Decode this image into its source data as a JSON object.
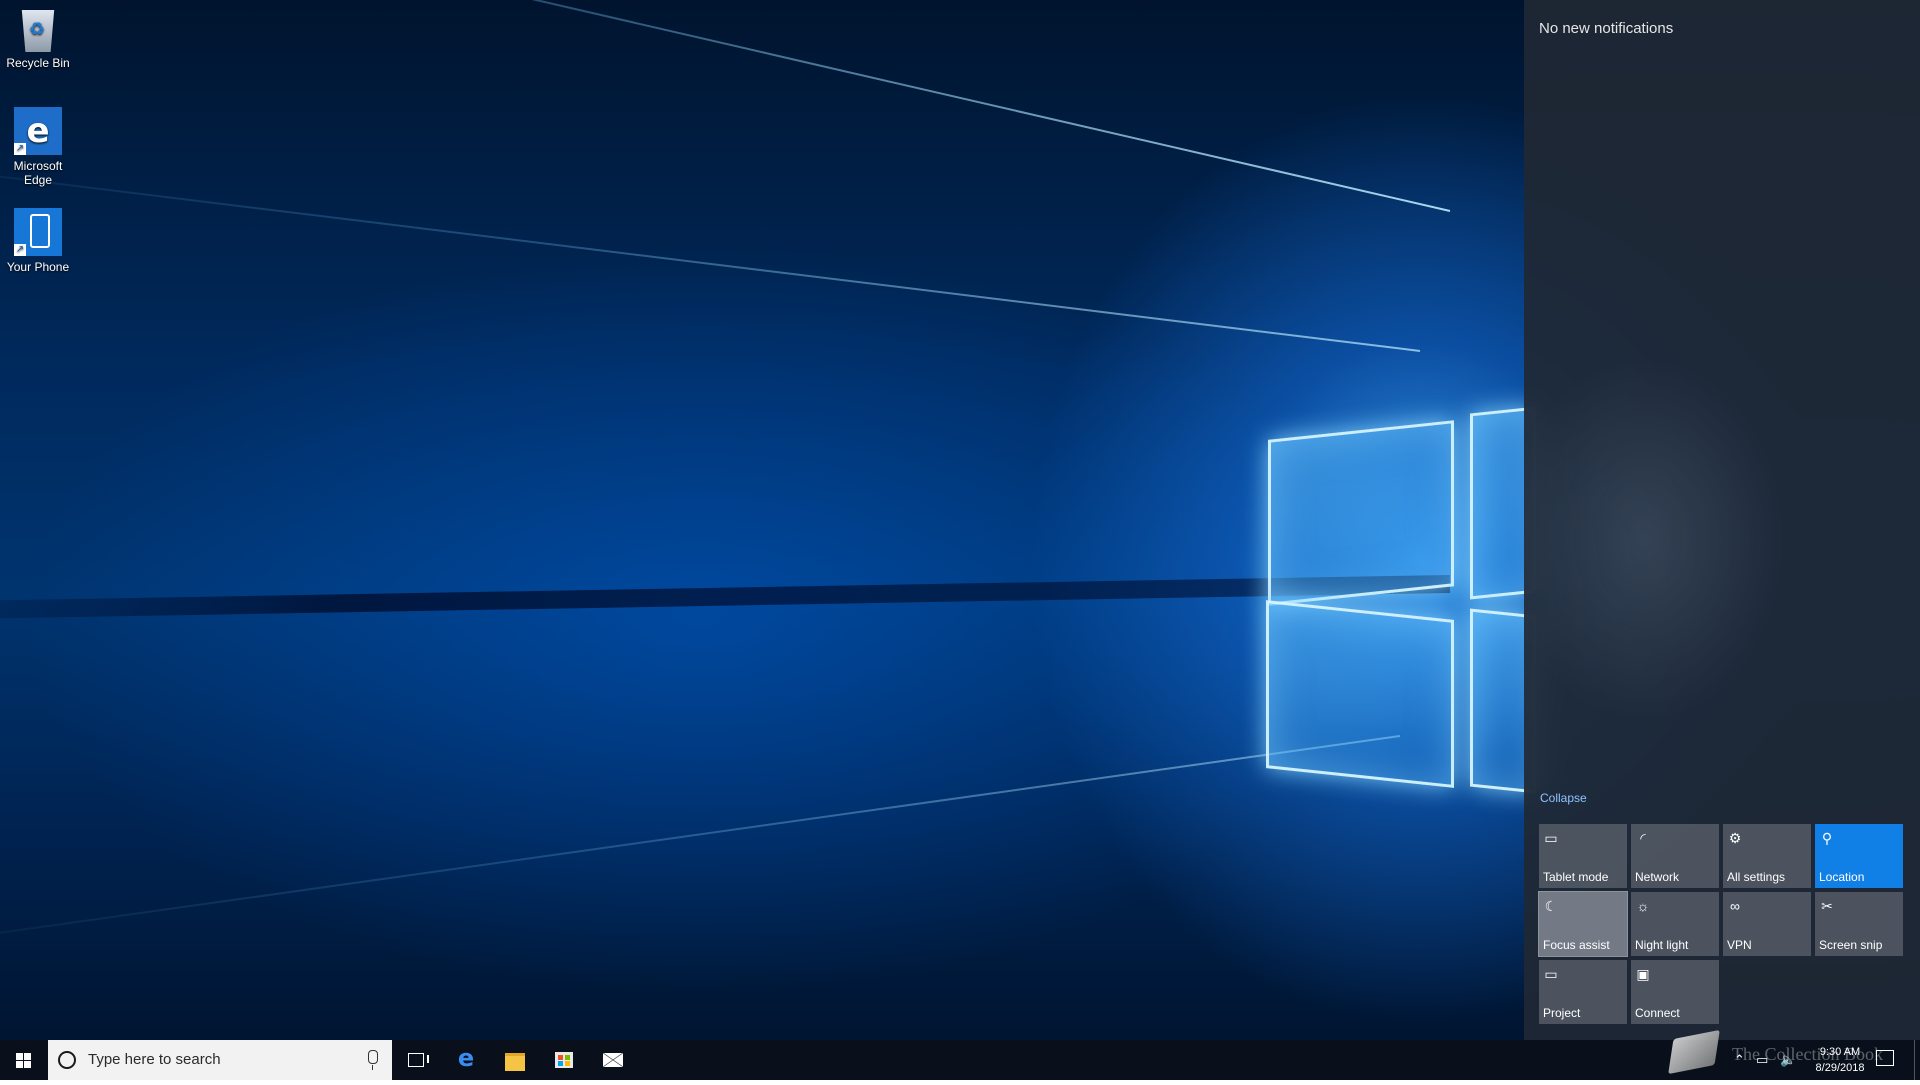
{
  "desktop": {
    "icons": [
      {
        "label": "Recycle Bin",
        "icon": "recycle-bin-icon"
      },
      {
        "label": "Microsoft Edge",
        "icon": "edge-icon"
      },
      {
        "label": "Your Phone",
        "icon": "phone-icon"
      }
    ]
  },
  "action_center": {
    "empty_message": "No new notifications",
    "collapse_label": "Collapse",
    "tiles": [
      {
        "label": "Tablet mode",
        "icon": "tablet-mode-icon",
        "glyph": "▭",
        "state": "off"
      },
      {
        "label": "Network",
        "icon": "network-icon",
        "glyph": "◜",
        "state": "off"
      },
      {
        "label": "All settings",
        "icon": "gear-icon",
        "glyph": "⚙",
        "state": "off"
      },
      {
        "label": "Location",
        "icon": "location-icon",
        "glyph": "⚲",
        "state": "on"
      },
      {
        "label": "Focus assist",
        "icon": "moon-icon",
        "glyph": "☾",
        "state": "hover"
      },
      {
        "label": "Night light",
        "icon": "sun-icon",
        "glyph": "☼",
        "state": "off"
      },
      {
        "label": "VPN",
        "icon": "vpn-icon",
        "glyph": "∞",
        "state": "off"
      },
      {
        "label": "Screen snip",
        "icon": "screen-snip-icon",
        "glyph": "✂",
        "state": "off"
      },
      {
        "label": "Project",
        "icon": "project-icon",
        "glyph": "▭",
        "state": "off"
      },
      {
        "label": "Connect",
        "icon": "connect-icon",
        "glyph": "▣",
        "state": "off"
      }
    ],
    "colors": {
      "active": "#1180e6",
      "tile": "#5c636c"
    }
  },
  "taskbar": {
    "search_placeholder": "Type here to search",
    "pinned": [
      {
        "name": "Task View",
        "icon": "task-view-icon"
      },
      {
        "name": "Microsoft Edge",
        "icon": "edge-icon"
      },
      {
        "name": "File Explorer",
        "icon": "folder-icon"
      },
      {
        "name": "Microsoft Store",
        "icon": "store-icon"
      },
      {
        "name": "Mail",
        "icon": "mail-icon"
      }
    ],
    "tray": {
      "time": "9:30 AM",
      "date": "8/29/2018"
    }
  },
  "watermark": {
    "text": "The Collection Book"
  }
}
